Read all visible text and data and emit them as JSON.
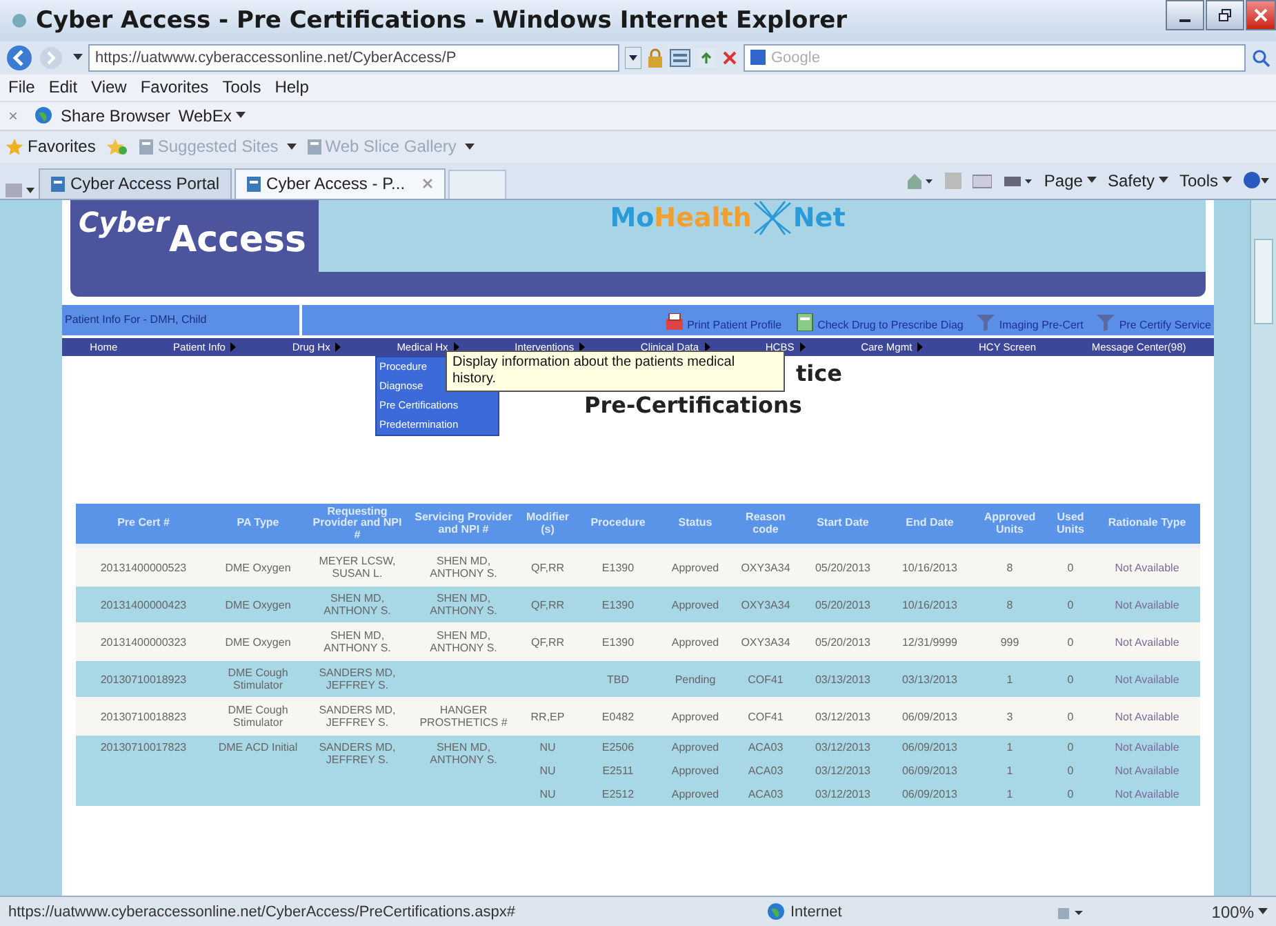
{
  "window": {
    "title": "Cyber Access - Pre Certifications - Windows Internet Explorer"
  },
  "address_bar": {
    "url": "https://uatwww.cyberaccessonline.net/CyberAccess/P",
    "search_placeholder": "Google"
  },
  "menu_bar": [
    "File",
    "Edit",
    "View",
    "Favorites",
    "Tools",
    "Help"
  ],
  "toolbar": {
    "close": "×",
    "items": [
      {
        "label": "Share Browser",
        "has_menu": false
      },
      {
        "label": "WebEx",
        "has_menu": true
      }
    ]
  },
  "favorites_bar": {
    "label": "Favorites",
    "links": [
      {
        "label": "Suggested Sites",
        "has_menu": true
      },
      {
        "label": "Web Slice Gallery",
        "has_menu": true
      }
    ]
  },
  "tabs": [
    {
      "label": "Cyber Access Portal",
      "selected": false
    },
    {
      "label": "Cyber Access - P...",
      "selected": true
    }
  ],
  "command_bar": [
    {
      "label": "Page",
      "has_menu": true
    },
    {
      "label": "Safety",
      "has_menu": true
    },
    {
      "label": "Tools",
      "has_menu": true
    }
  ],
  "page": {
    "logo": {
      "first": "Cyber",
      "second": "Access"
    },
    "partner_logo": {
      "first": "Mo",
      "second": "Health",
      "third": "Net"
    },
    "patient_bar": {
      "label": "Patient Info For - DMH, Child",
      "links": [
        {
          "label": "Print Patient Profile"
        },
        {
          "label": "Check Drug to Prescribe Diag"
        },
        {
          "label": "Imaging Pre-Cert"
        },
        {
          "label": "Pre Certify Service"
        }
      ]
    },
    "nav": [
      {
        "label": "Home",
        "has_menu": false
      },
      {
        "label": "Patient Info",
        "has_menu": true
      },
      {
        "label": "Drug Hx",
        "has_menu": true
      },
      {
        "label": "Medical Hx",
        "has_menu": true
      },
      {
        "label": "Interventions",
        "has_menu": true
      },
      {
        "label": "Clinical Data",
        "has_menu": true
      },
      {
        "label": "HCBS",
        "has_menu": true
      },
      {
        "label": "Care Mgmt",
        "has_menu": true
      },
      {
        "label": "HCY Screen",
        "has_menu": false
      },
      {
        "label": "Message Center(98)",
        "has_menu": false
      }
    ],
    "dropdown": [
      "Procedure",
      "Diagnose",
      "Pre Certifications",
      "Predetermination"
    ],
    "tooltip": "Display information about the patients medical history.",
    "heading_fragment": "tice",
    "heading": "Pre-Certifications",
    "table": {
      "columns": [
        "Pre Cert #",
        "PA Type",
        "Requesting Provider and NPI #",
        "Servicing Provider and NPI #",
        "Modifier (s)",
        "Procedure",
        "Status",
        "Reason code",
        "Start Date",
        "End Date",
        "Approved Units",
        "Used Units",
        "Rationale Type"
      ],
      "rows": [
        {
          "cells": [
            "20131400000523",
            "DME Oxygen",
            "MEYER LCSW, SUSAN L.",
            "SHEN MD, ANTHONY S.",
            "QF,RR",
            "E1390",
            "Approved",
            "OXY3A34",
            "05/20/2013",
            "10/16/2013",
            "8",
            "0",
            "Not Available"
          ]
        },
        {
          "cells": [
            "20131400000423",
            "DME Oxygen",
            "SHEN MD, ANTHONY S.",
            "SHEN MD, ANTHONY S.",
            "QF,RR",
            "E1390",
            "Approved",
            "OXY3A34",
            "05/20/2013",
            "10/16/2013",
            "8",
            "0",
            "Not Available"
          ]
        },
        {
          "cells": [
            "20131400000323",
            "DME Oxygen",
            "SHEN MD, ANTHONY S.",
            "SHEN MD, ANTHONY S.",
            "QF,RR",
            "E1390",
            "Approved",
            "OXY3A34",
            "05/20/2013",
            "12/31/9999",
            "999",
            "0",
            "Not Available"
          ]
        },
        {
          "cells": [
            "20130710018923",
            "DME Cough Stimulator",
            "SANDERS MD, JEFFREY S.",
            "",
            "",
            "TBD",
            "Pending",
            "COF41",
            "03/13/2013",
            "03/13/2013",
            "1",
            "0",
            "Not Available"
          ]
        },
        {
          "cells": [
            "20130710018823",
            "DME Cough Stimulator",
            "SANDERS MD, JEFFREY S.",
            "HANGER PROSTHETICS #",
            "RR,EP",
            "E0482",
            "Approved",
            "COF41",
            "03/12/2013",
            "06/09/2013",
            "3",
            "0",
            "Not Available"
          ]
        },
        {
          "cells": [
            "20130710017823",
            "DME ACD Initial",
            "SANDERS MD, JEFFREY S.",
            "SHEN MD, ANTHONY S.",
            "NU",
            "E2506",
            "Approved",
            "ACA03",
            "03/12/2013",
            "06/09/2013",
            "1",
            "0",
            "Not Available"
          ],
          "more": [
            [
              "NU",
              "E2511",
              "Approved",
              "ACA03",
              "03/12/2013",
              "06/09/2013",
              "1",
              "0",
              "Not Available"
            ],
            [
              "NU",
              "E2512",
              "Approved",
              "ACA03",
              "03/12/2013",
              "06/09/2013",
              "1",
              "0",
              "Not Available"
            ]
          ]
        }
      ]
    }
  },
  "status_bar": {
    "url": "https://uatwww.cyberaccessonline.net/CyberAccess/PreCertifications.aspx#",
    "zone": "Internet",
    "zoom": "100%"
  }
}
